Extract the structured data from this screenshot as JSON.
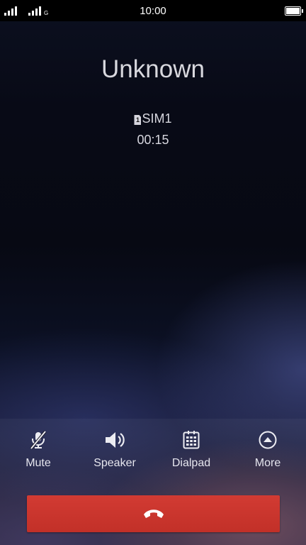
{
  "status_bar": {
    "time": "10:00",
    "sim1_network": "",
    "sim2_network": "G",
    "icons": [
      "signal-sim1-icon",
      "signal-sim2-icon",
      "battery-icon"
    ]
  },
  "call": {
    "caller_name": "Unknown",
    "sim_badge": "1",
    "sim_label": "SIM1",
    "duration": "00:15"
  },
  "controls": {
    "mute_label": "Mute",
    "speaker_label": "Speaker",
    "dialpad_label": "Dialpad",
    "more_label": "More",
    "icons": [
      "mic-off-icon",
      "speaker-icon",
      "dialpad-icon",
      "more-icon",
      "end-call-icon"
    ]
  },
  "colors": {
    "end_call": "#c9332b",
    "text": "#e8e8ee",
    "status_bar_bg": "#000000"
  }
}
